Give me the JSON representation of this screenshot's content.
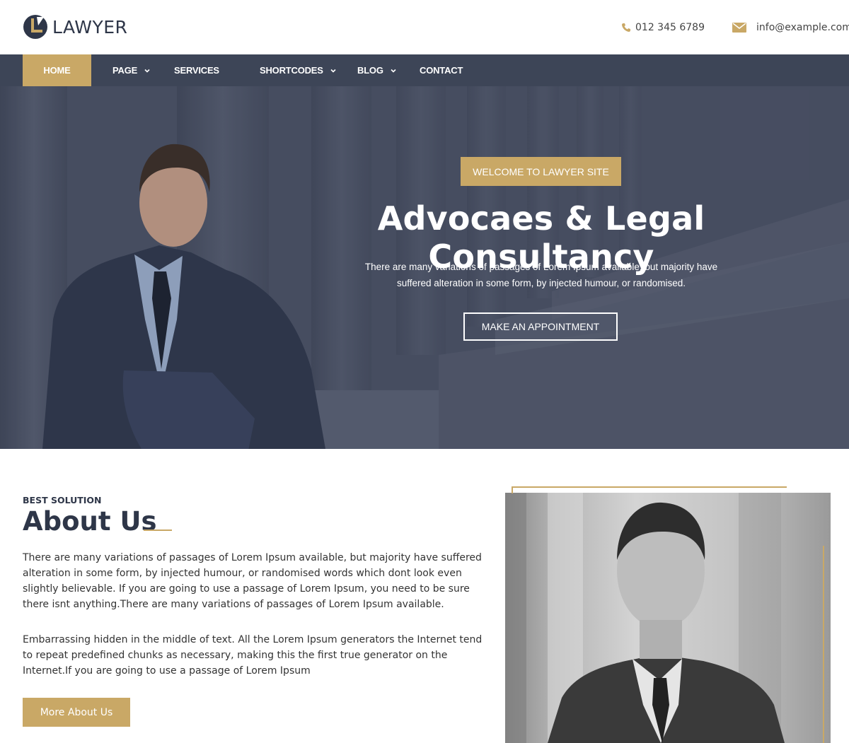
{
  "header": {
    "logo_text": "LAWYER",
    "phone": "012 345 6789",
    "email": "info@example.com"
  },
  "nav": {
    "items": [
      {
        "label": "HOME",
        "active": true,
        "dropdown": false
      },
      {
        "label": "PAGE",
        "active": false,
        "dropdown": true
      },
      {
        "label": "SERVICES",
        "active": false,
        "dropdown": false
      },
      {
        "label": "SHORTCODES",
        "active": false,
        "dropdown": true
      },
      {
        "label": "BLOG",
        "active": false,
        "dropdown": true
      },
      {
        "label": "CONTACT",
        "active": false,
        "dropdown": false
      }
    ]
  },
  "hero": {
    "badge": "WELCOME TO LAWYER SITE",
    "title": "Advocaes & Legal Consultancy",
    "description": "There are many variations of passages of Lorem Ipsum available, but majority have suffered alteration in some form, by injected humour, or randomised.",
    "button": "MAKE AN APPOINTMENT"
  },
  "about": {
    "eyebrow": "BEST SOLUTION",
    "title": "About Us",
    "paragraph1": "There are many variations of passages of Lorem Ipsum available, but majority have suffered alteration in some form, by injected humour, or randomised words which dont look even slightly believable. If you are going to use a passage of Lorem Ipsum, you need to be sure there isnt anything.There are many variations of passages of Lorem Ipsum available.",
    "paragraph2": "Embarrassing hidden in the middle of text. All the Lorem Ipsum generators the Internet tend to repeat predefined chunks as necessary, making this the first true generator on the Internet.If you are going to use a passage of Lorem Ipsum",
    "button": "More About Us"
  },
  "colors": {
    "accent": "#c9a866",
    "nav_bg": "#3d4557",
    "dark_text": "#2e3648"
  },
  "icons": {
    "phone": "phone-icon",
    "email": "envelope-icon",
    "dropdown": "chevron-down-icon"
  }
}
